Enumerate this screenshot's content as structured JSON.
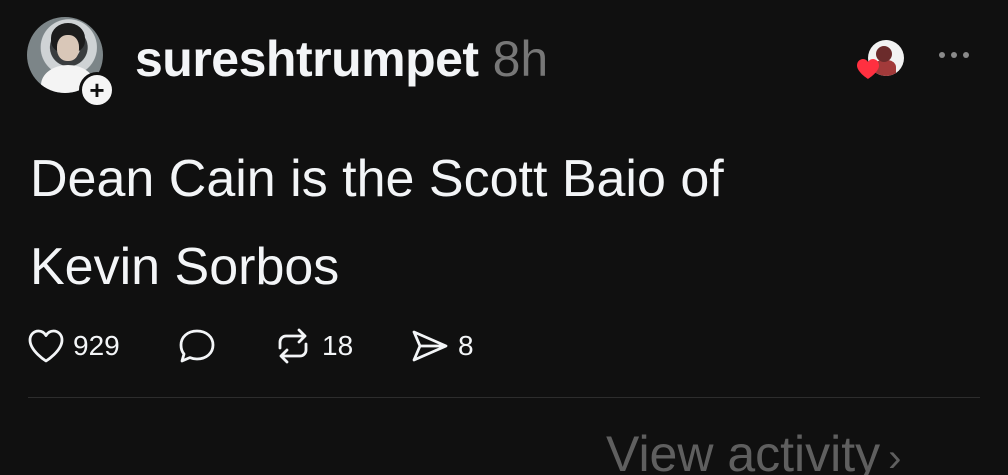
{
  "post": {
    "author": {
      "username": "sureshtrumpet",
      "avatar_icon": "user-avatar-photo",
      "follow_badge": "+"
    },
    "timestamp": "8h",
    "text_lines": [
      "Dean Cain is the Scott Baio of",
      "Kevin Sorbos"
    ],
    "liked_by_icon": "liker-avatar-photo",
    "actions": {
      "likes": "929",
      "replies": "",
      "reposts": "18",
      "shares": "8"
    },
    "footer_link": "View activity",
    "footer_chevron": "›"
  },
  "colors": {
    "background": "#101010",
    "text": "#f3f5f7",
    "muted": "#777777",
    "heart": "#ff3040"
  }
}
